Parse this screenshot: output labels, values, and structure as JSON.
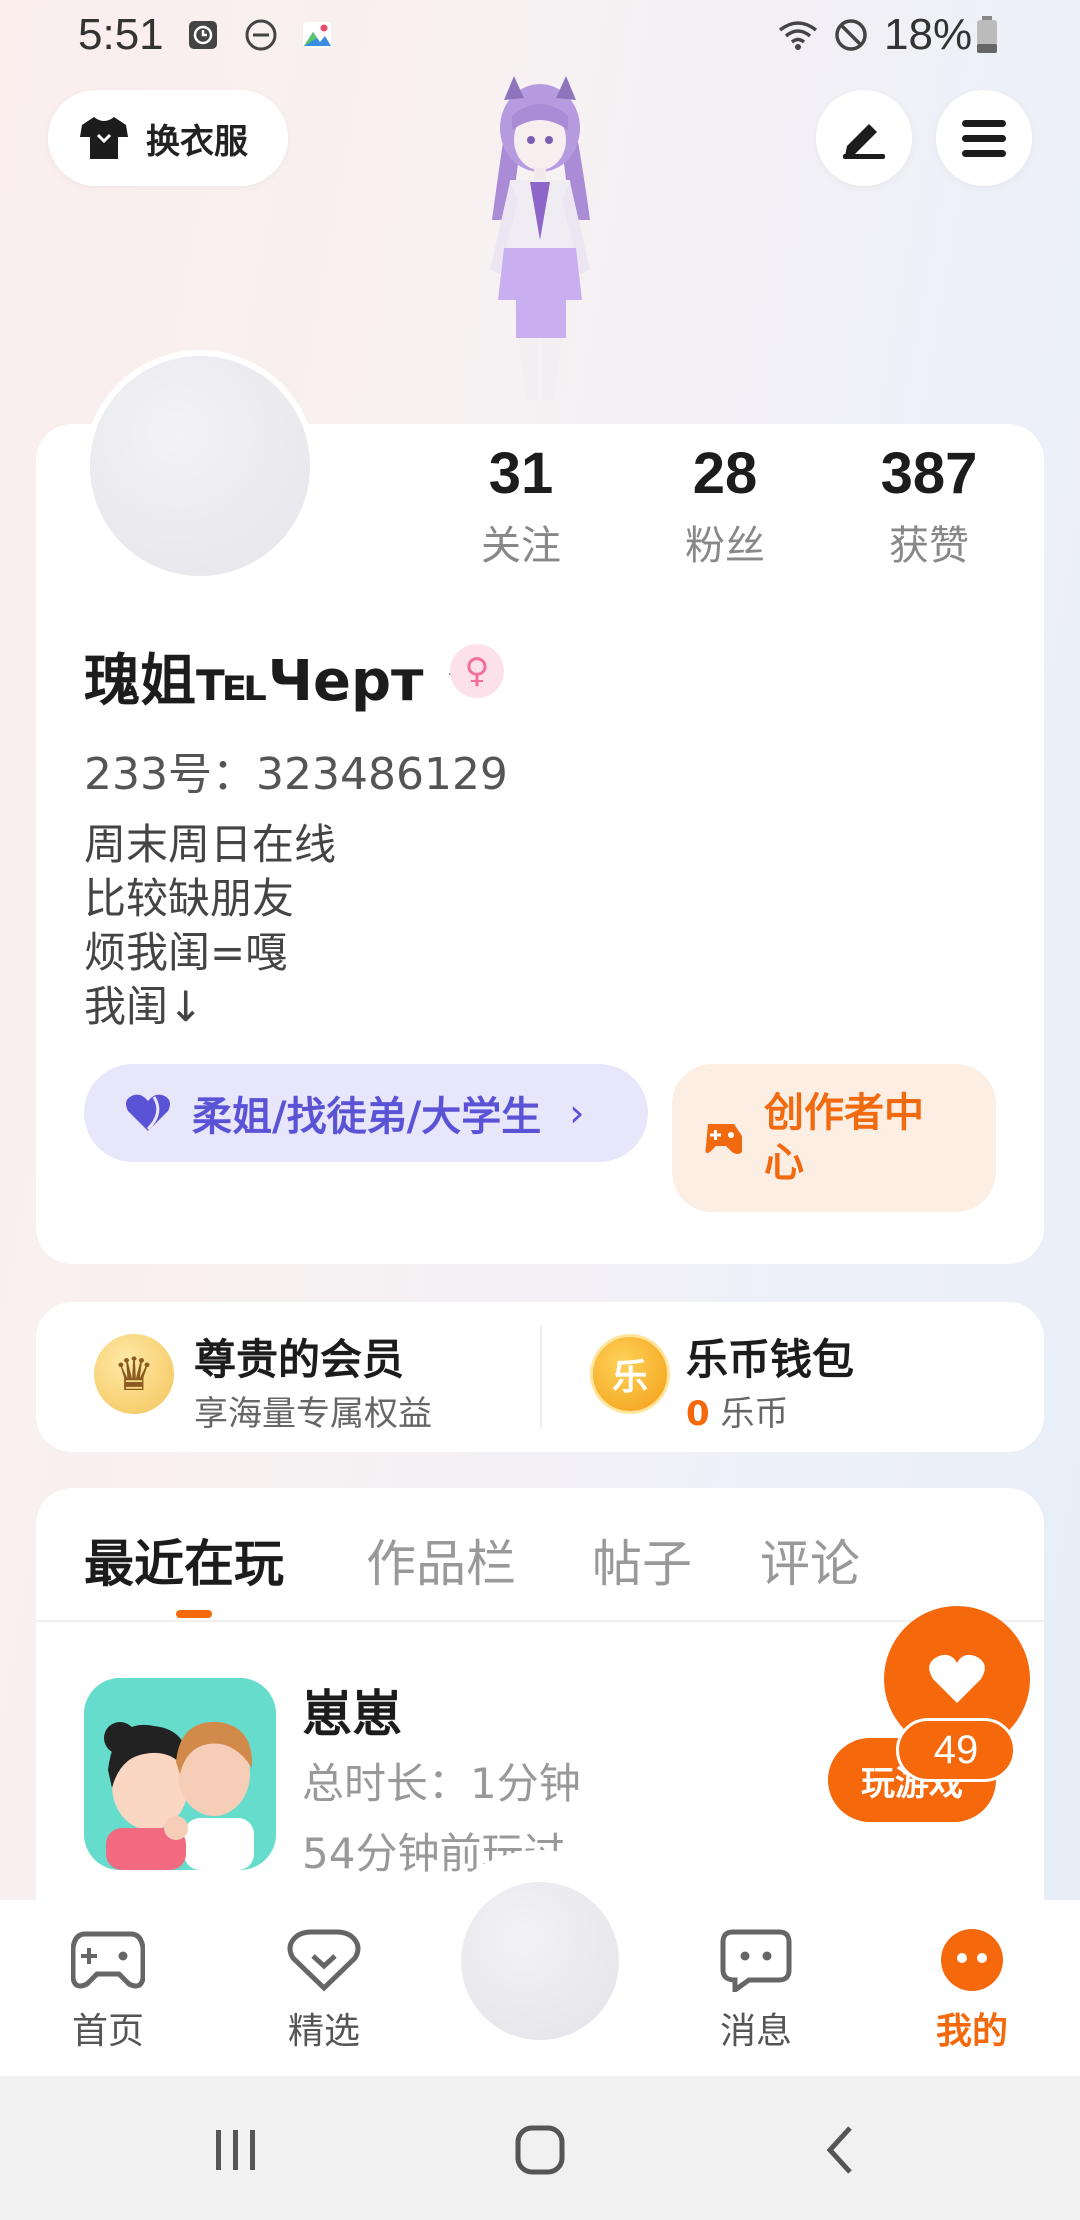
{
  "status_bar": {
    "time": "5:51",
    "battery": "18%"
  },
  "header": {
    "outfit_label": "换衣服"
  },
  "profile": {
    "stats": [
      {
        "value": "31",
        "label": "关注"
      },
      {
        "value": "28",
        "label": "粉丝"
      },
      {
        "value": "387",
        "label": "获赞"
      }
    ],
    "username": "瑰姐℡Черт ^",
    "user_id": "233号：323486129",
    "bio": [
      "周末周日在线",
      "比较缺朋友",
      "烦我闺=嘎",
      "我闺↓"
    ],
    "tag_label": "柔姐/找徒弟/大学生",
    "creator_label": "创作者中心"
  },
  "vip": {
    "title": "尊贵的会员",
    "subtitle": "享海量专属权益",
    "crown_glyph": "♛"
  },
  "wallet": {
    "title": "乐币钱包",
    "coin_glyph": "乐",
    "amount": "0",
    "unit": "乐币"
  },
  "tabs": [
    {
      "label": "最近在玩",
      "active": true
    },
    {
      "label": "作品栏",
      "active": false
    },
    {
      "label": "帖子",
      "active": false
    },
    {
      "label": "评论",
      "active": false
    }
  ],
  "recent_game": {
    "title": "崽崽",
    "duration": "总时长：1分钟",
    "last_played": "54分钟前玩过",
    "play_label": "玩游戏"
  },
  "like_fab": {
    "count": "49"
  },
  "bottom_nav": [
    {
      "label": "首页",
      "icon": "gamepad-icon"
    },
    {
      "label": "精选",
      "icon": "heart-box-icon"
    },
    {
      "label": "消息",
      "icon": "chat-icon"
    },
    {
      "label": "我的",
      "icon": "profile-icon",
      "active": true
    }
  ],
  "colors": {
    "accent": "#f5680b",
    "tag_bg": "#e8e6fb",
    "tag_fg": "#5b53d6"
  }
}
